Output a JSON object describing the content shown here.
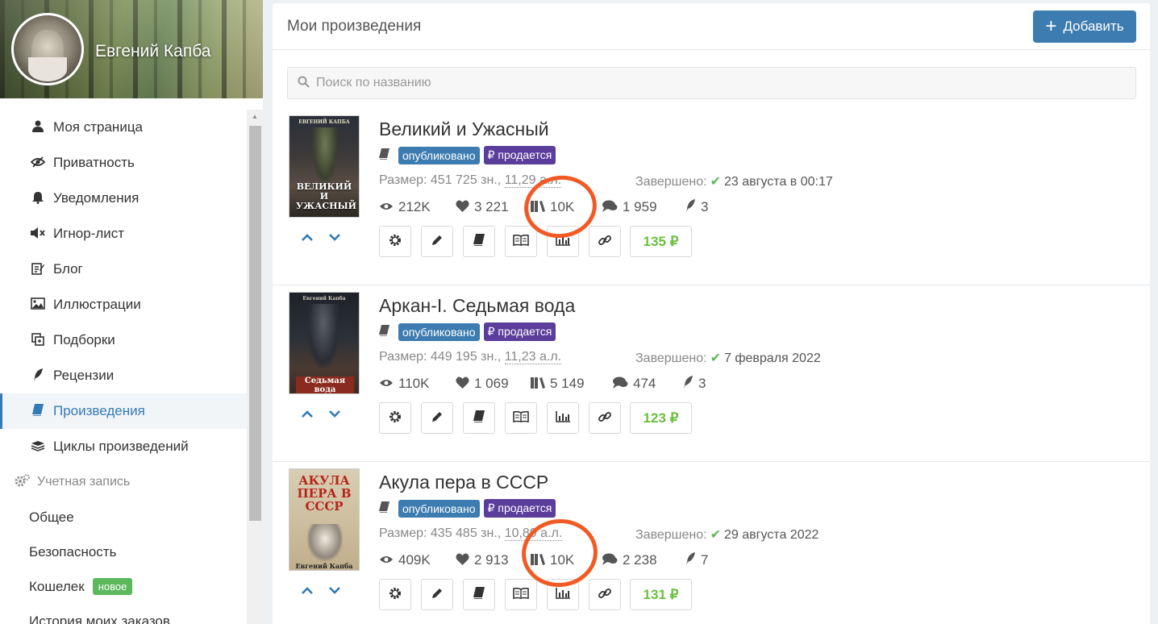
{
  "profile": {
    "name": "Евгений Капба"
  },
  "sidebar": {
    "items": [
      {
        "label": "Моя страница",
        "icon": "user-icon"
      },
      {
        "label": "Приватность",
        "icon": "eye-slash-icon"
      },
      {
        "label": "Уведомления",
        "icon": "bell-icon"
      },
      {
        "label": "Игнор-лист",
        "icon": "mute-icon"
      },
      {
        "label": "Блог",
        "icon": "edit-icon"
      },
      {
        "label": "Иллюстрации",
        "icon": "picture-icon"
      },
      {
        "label": "Подборки",
        "icon": "collection-icon"
      },
      {
        "label": "Рецензии",
        "icon": "quill-icon"
      },
      {
        "label": "Произведения",
        "icon": "book-icon",
        "active": true
      },
      {
        "label": "Циклы произведений",
        "icon": "stack-icon"
      }
    ],
    "account_section": "Учетная запись",
    "account_items": [
      {
        "label": "Общее"
      },
      {
        "label": "Безопасность"
      },
      {
        "label": "Кошелек",
        "badge": "новое"
      },
      {
        "label": "История моих заказов"
      }
    ]
  },
  "main": {
    "title": "Мои произведения",
    "add_button": "Добавить",
    "search_placeholder": "Поиск по названию"
  },
  "labels": {
    "published": "опубликовано",
    "for_sale": "продается",
    "size_prefix": "Размер:",
    "completed": "Завершено:"
  },
  "works": [
    {
      "title": "Великий и Ужасный",
      "cover_author": "ЕВГЕНИЙ КАПБА",
      "cover_title": "ВЕЛИКИЙ И УЖАСНЫЙ",
      "size_chars": "451 725 зн., ",
      "size_al": "11,29 а.л.",
      "date": "23 августа в 00:17",
      "views": "212K",
      "likes": "3 221",
      "libraries": "10K",
      "comments": "1 959",
      "reviews": "3",
      "price": "135 ₽",
      "highlighted": true
    },
    {
      "title": "Аркан-I. Седьмая вода",
      "cover_author": "Евгений Капба",
      "cover_title": "Седьмая вода",
      "size_chars": "449 195 зн., ",
      "size_al": "11,23 а.л.",
      "date": "7 февраля 2022",
      "views": "110K",
      "likes": "1 069",
      "libraries": "5 149",
      "comments": "474",
      "reviews": "3",
      "price": "123 ₽",
      "highlighted": false
    },
    {
      "title": "Акула пера в СССР",
      "cover_author": "Евгений Капба",
      "cover_title": "АКУЛА ПЕРА В СССР",
      "size_chars": "435 485 зн., ",
      "size_al": "10,89 а.л.",
      "date": "29 августа 2022",
      "views": "409K",
      "likes": "2 913",
      "libraries": "10K",
      "comments": "2 238",
      "reviews": "7",
      "price": "131 ₽",
      "highlighted": true
    }
  ],
  "colors": {
    "accent": "#337ab7",
    "published": "#3d7cb0",
    "for_sale": "#5b3d9b",
    "price": "#6bbf3e",
    "highlight_circle": "#f25a24"
  }
}
